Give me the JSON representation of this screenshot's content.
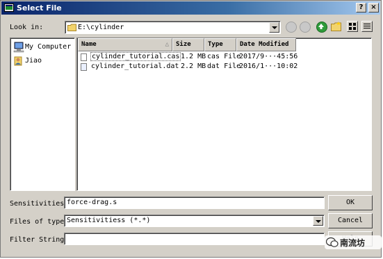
{
  "window": {
    "title": "Select File",
    "help_glyph": "?",
    "close_glyph": "×"
  },
  "lookin": {
    "label": "Look in:",
    "path": "E:\\cylinder"
  },
  "places": [
    {
      "label": "My Computer",
      "icon": "computer-icon"
    },
    {
      "label": "Jiao",
      "icon": "user-icon"
    }
  ],
  "columns": {
    "name": "Name",
    "size": "Size",
    "type": "Type",
    "date": "Date Modified"
  },
  "files": [
    {
      "name": "cylinder_tutorial.cas",
      "size": "1.2 MB",
      "type": "cas File",
      "date": "2017/9···45:56"
    },
    {
      "name": "cylinder_tutorial.dat",
      "size": "2.2 MB",
      "type": "dat File",
      "date": "2016/1···10:02"
    }
  ],
  "sensitivities": {
    "label": "Sensitivities",
    "value": "force-drag.s"
  },
  "filetype": {
    "label": "Files of type:",
    "value": "Sensitivitiess (*.*)"
  },
  "filter": {
    "label": "Filter String",
    "value": ""
  },
  "buttons": {
    "ok": "OK",
    "cancel": "Cancel",
    "help": "Help"
  },
  "watermark": {
    "text": "南流坊"
  },
  "colors": {
    "titlebar_start": "#0a246a",
    "titlebar_end": "#a6caf0",
    "face": "#d4d0c8"
  }
}
